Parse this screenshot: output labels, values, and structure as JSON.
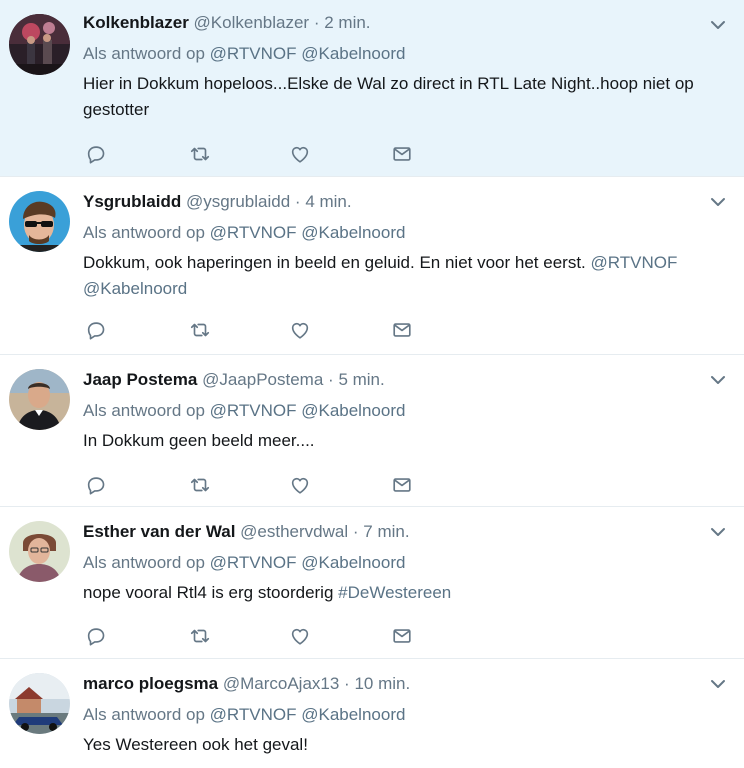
{
  "tweets": [
    {
      "name": "Kolkenblazer",
      "handle": "@Kolkenblazer",
      "time": "2 min.",
      "reply_prefix": "Als antwoord op",
      "reply_to_1": "@RTVNOF",
      "reply_to_2": "@Kabelnoord",
      "text": "Hier in Dokkum hopeloos...Elske de Wal zo direct in RTL Late Night..hoop niet op gestotter",
      "text_link": "",
      "highlighted": true
    },
    {
      "name": "Ysgrublaidd",
      "handle": "@ysgrublaidd",
      "time": "4 min.",
      "reply_prefix": "Als antwoord op",
      "reply_to_1": "@RTVNOF",
      "reply_to_2": "@Kabelnoord",
      "text": "Dokkum, ook haperingen in beeld en geluid. En niet voor het eerst.",
      "text_link": "@RTVNOF @Kabelnoord",
      "highlighted": false
    },
    {
      "name": "Jaap Postema",
      "handle": "@JaapPostema",
      "time": "5 min.",
      "reply_prefix": "Als antwoord op",
      "reply_to_1": "@RTVNOF",
      "reply_to_2": "@Kabelnoord",
      "text": "In Dokkum geen beeld meer....",
      "text_link": "",
      "highlighted": false
    },
    {
      "name": "Esther van der Wal",
      "handle": "@esthervdwal",
      "time": "7 min.",
      "reply_prefix": "Als antwoord op",
      "reply_to_1": "@RTVNOF",
      "reply_to_2": "@Kabelnoord",
      "text": "nope vooral Rtl4 is erg stoorderig",
      "text_link": "#DeWestereen",
      "highlighted": false
    },
    {
      "name": "marco ploegsma",
      "handle": "@MarcoAjax13",
      "time": "10 min.",
      "reply_prefix": "Als antwoord op",
      "reply_to_1": "@RTVNOF",
      "reply_to_2": "@Kabelnoord",
      "text": "Yes Westereen ook het geval!",
      "text_link": "",
      "highlighted": false
    }
  ],
  "separator": "·",
  "icons": {
    "reply": "reply-icon",
    "retweet": "retweet-icon",
    "like": "heart-icon",
    "dm": "envelope-icon",
    "more": "chevron-down-icon"
  },
  "colors": {
    "highlight_bg": "#e8f4fb",
    "icon": "#657786",
    "link": "#5a7386",
    "divider": "#e6ecf0"
  }
}
